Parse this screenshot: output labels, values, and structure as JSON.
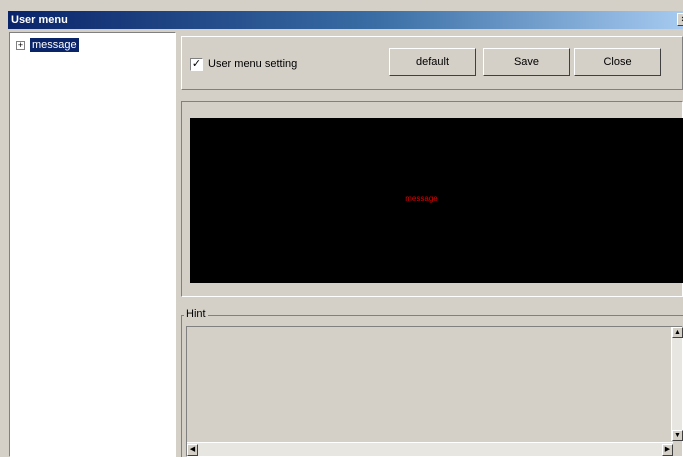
{
  "window": {
    "title": "User menu",
    "title_button_icon": "close-icon"
  },
  "tree": {
    "items": [
      {
        "label": "message",
        "expander": "⊞"
      }
    ]
  },
  "toolbar": {
    "setting_checked": true,
    "setting_label": "User menu setting",
    "default_label": "default",
    "save_label": "Save",
    "close_label": "Close"
  },
  "display": {
    "background": "#000000",
    "text": "message",
    "text_color": "#e00000"
  },
  "hint": {
    "label": "Hint",
    "text": ""
  },
  "colors": {
    "titlebar_start": "#0a246a",
    "titlebar_end": "#a6caf0",
    "selection": "#0a246a"
  }
}
